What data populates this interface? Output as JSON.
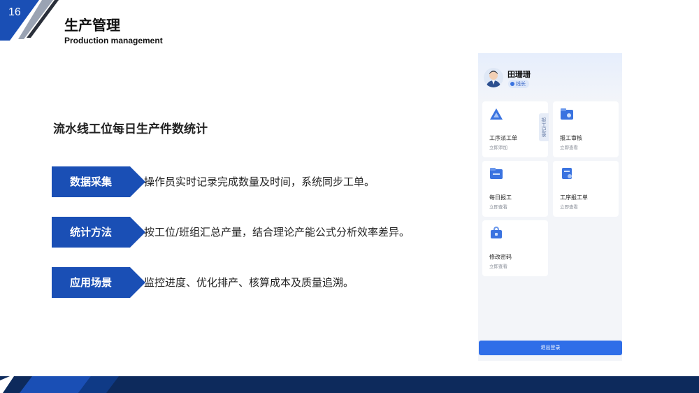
{
  "slide": {
    "page_number": "16",
    "title": "生产管理",
    "subtitle": "Production management"
  },
  "content": {
    "heading": "流水线工位每日生产件数统计",
    "rows": [
      {
        "tag": "数据采集",
        "text": "操作员实时记录完成数量及时间，系统同步工单。"
      },
      {
        "tag": "统计方法",
        "text": "按工位/班组汇总产量，结合理论产能公式分析效率差异。"
      },
      {
        "tag": "应用场景",
        "text": "监控进度、优化排产、核算成本及质量追溯。"
      }
    ]
  },
  "phone": {
    "user_name": "田珊珊",
    "role": "线长",
    "side_tab": "报工记录",
    "cards": [
      {
        "label": "工序派工单",
        "sub": "立即添加",
        "icon": "dispatch-triangle-icon"
      },
      {
        "label": "报工审核",
        "sub": "立即查看",
        "icon": "review-folder-icon"
      },
      {
        "label": "每日报工",
        "sub": "立即查看",
        "icon": "daily-report-folder-icon"
      },
      {
        "label": "工序报工单",
        "sub": "立即查看",
        "icon": "process-report-doc-icon"
      },
      {
        "label": "修改密码",
        "sub": "立即查看",
        "icon": "password-bag-icon"
      }
    ],
    "logout_label": "退出登录"
  },
  "colors": {
    "primary": "#1a4fb5",
    "navy": "#0d2a5c",
    "button": "#2f6ee8"
  }
}
